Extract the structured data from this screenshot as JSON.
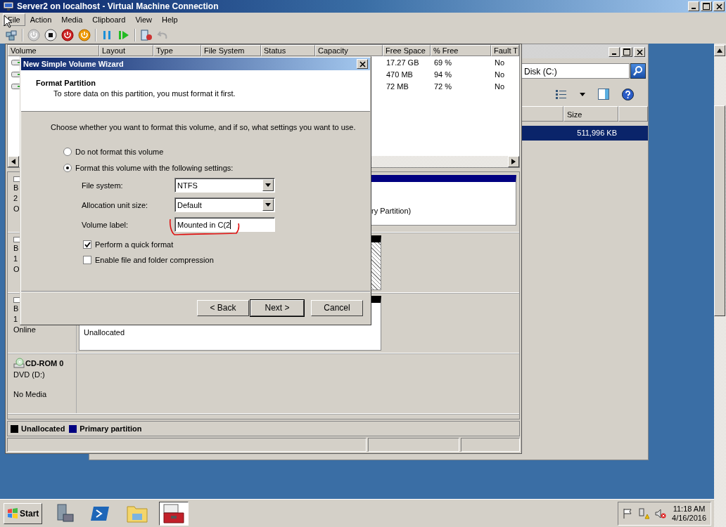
{
  "window": {
    "title": "Server2 on localhost - Virtual Machine Connection"
  },
  "menu": [
    {
      "label": "File",
      "selected": true
    },
    {
      "label": "Action",
      "selected": false
    },
    {
      "label": "Media",
      "selected": false
    },
    {
      "label": "Clipboard",
      "selected": false
    },
    {
      "label": "View",
      "selected": false
    },
    {
      "label": "Help",
      "selected": false
    }
  ],
  "disk_list": {
    "columns": [
      "Volume",
      "Layout",
      "Type",
      "File System",
      "Status",
      "Capacity",
      "Free Space",
      "% Free",
      "Fault T"
    ],
    "rows": [
      {
        "free_space": "17.27 GB",
        "percent_free": "69 %",
        "fault_tolerance": "No"
      },
      {
        "free_space": "470 MB",
        "percent_free": "94 %",
        "fault_tolerance": "No"
      },
      {
        "free_space": "72 MB",
        "percent_free": "72 %",
        "fault_tolerance": "No"
      }
    ]
  },
  "disk_map": {
    "disks": [
      {
        "label_lines": [
          "B",
          "2",
          "O"
        ],
        "kind": "primary",
        "partition_text": "ry Partition)"
      },
      {
        "label_lines": [
          "B",
          "1",
          "O"
        ],
        "kind": "hatched"
      },
      {
        "label_lines": [
          "B",
          "1",
          "Online"
        ],
        "kind": "unallocated",
        "partition_text": "Unallocated"
      }
    ],
    "cdrom": {
      "name": "CD-ROM 0",
      "drive": "DVD (D:)",
      "status": "No Media"
    },
    "legend": [
      {
        "label": "Unallocated",
        "color": "#000000"
      },
      {
        "label": "Primary partition",
        "color": "#000080"
      }
    ]
  },
  "explorer": {
    "address": "Disk (C:)",
    "columns": [
      "Size"
    ],
    "rows": [
      {
        "size": "511,996 KB",
        "selected": true
      }
    ]
  },
  "wizard": {
    "title": "New Simple Volume Wizard",
    "heading": "Format Partition",
    "subheading": "To store data on this partition, you must format it first.",
    "instruction": "Choose whether you want to format this volume, and if so, what settings you want to use.",
    "options": [
      {
        "label": "Do not format this volume",
        "selected": false
      },
      {
        "label": "Format this volume with the following settings:",
        "selected": true
      }
    ],
    "fields": [
      {
        "kind": "dropdown",
        "label": "File system:",
        "value": "NTFS"
      },
      {
        "kind": "dropdown",
        "label": "Allocation unit size:",
        "value": "Default"
      },
      {
        "kind": "text",
        "label": "Volume label:",
        "value": "Mounted in C(2"
      }
    ],
    "checkboxes": [
      {
        "label": "Perform a quick format",
        "checked": true
      },
      {
        "label": "Enable file and folder compression",
        "checked": false
      }
    ],
    "buttons": [
      {
        "label": "< Back",
        "default": false
      },
      {
        "label": "Next >",
        "default": true
      },
      {
        "label": "Cancel",
        "default": false
      }
    ]
  },
  "taskbar": {
    "start": "Start",
    "apps": [
      {
        "kind": "server",
        "selected": false
      },
      {
        "kind": "powershell",
        "selected": false
      },
      {
        "kind": "folder",
        "selected": false
      },
      {
        "kind": "toolbox",
        "selected": true
      }
    ],
    "time": "11:18 AM",
    "date": "4/16/2016"
  }
}
